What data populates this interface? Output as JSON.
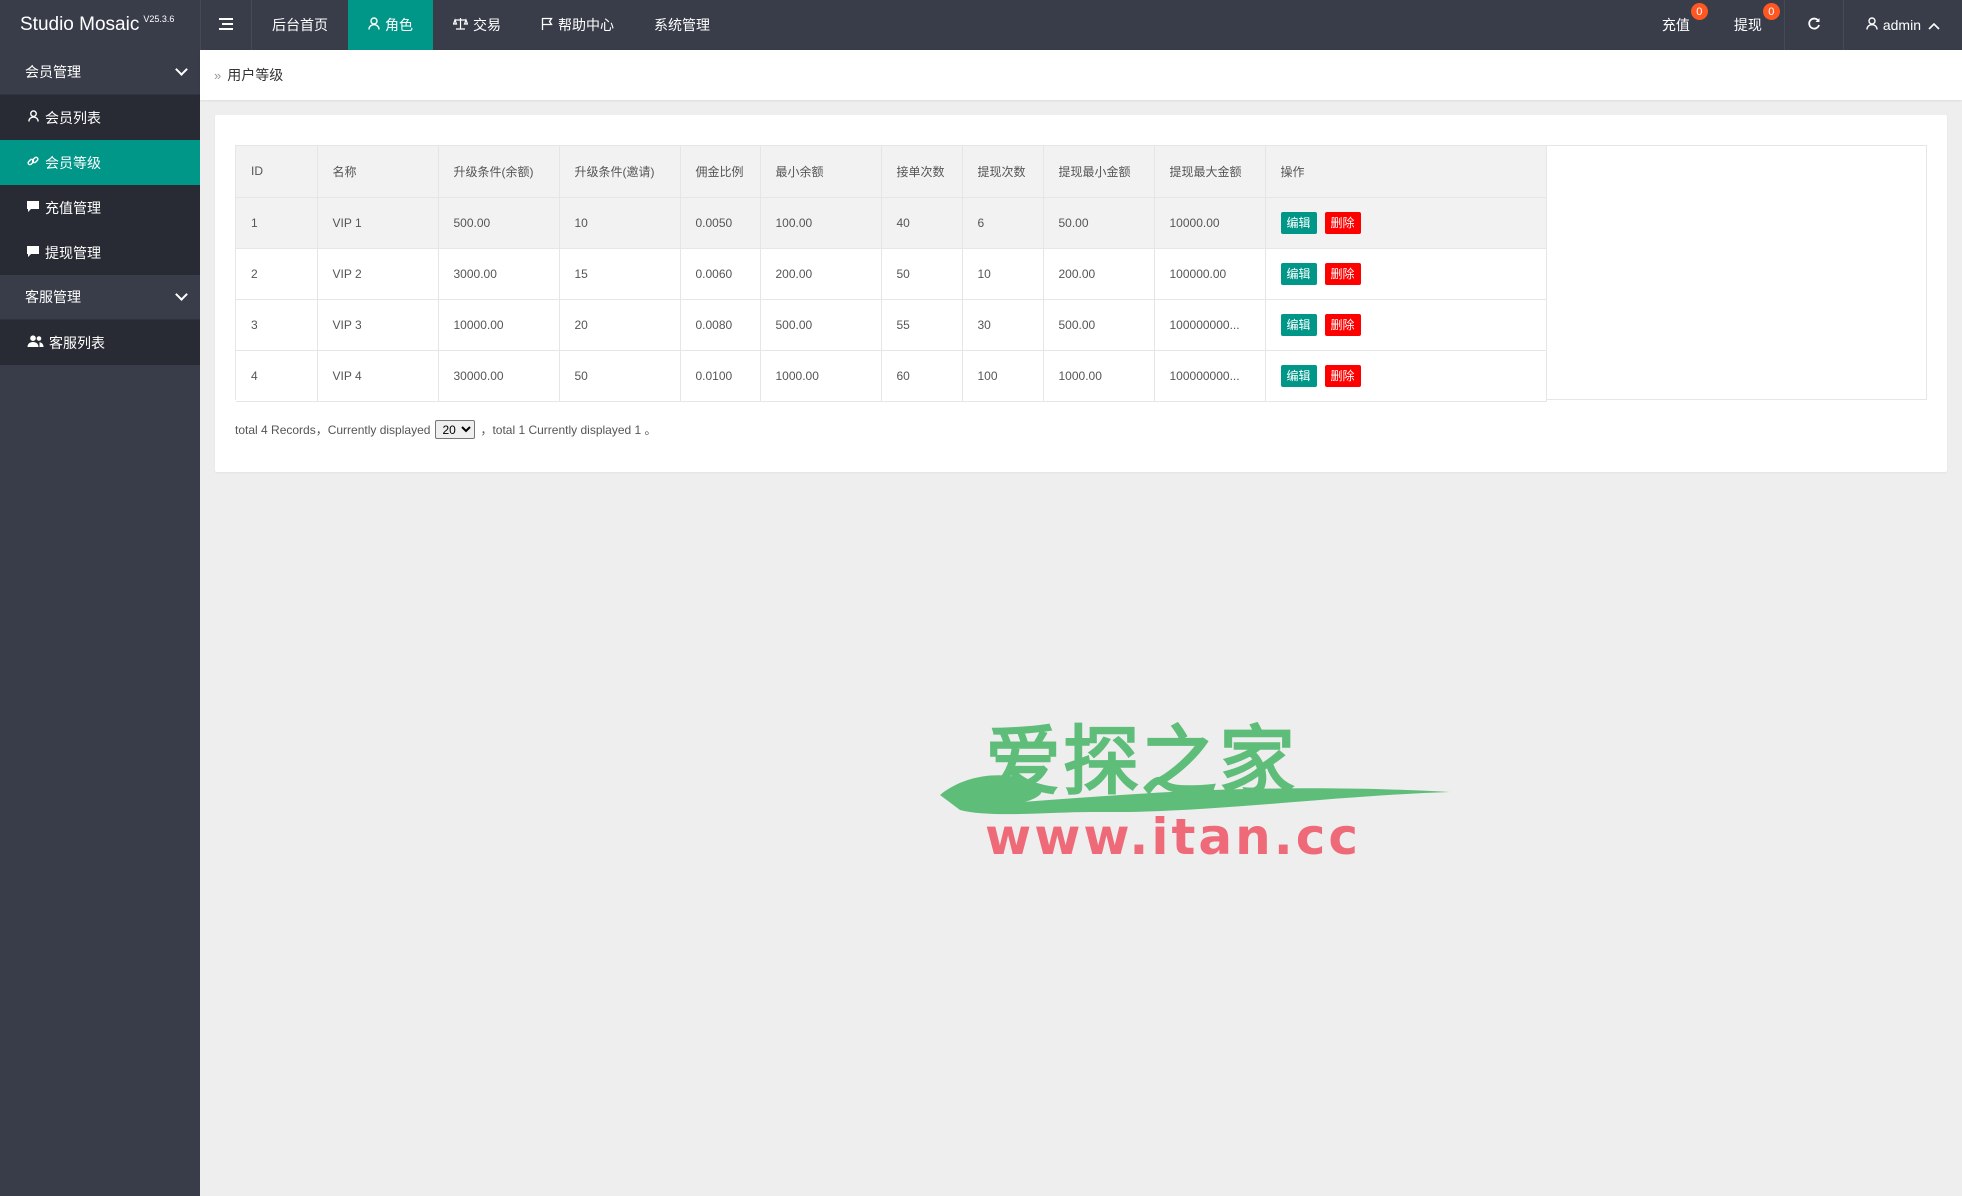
{
  "app": {
    "name": "Studio Mosaic",
    "version": "V25.3.6"
  },
  "topnav": {
    "items": [
      {
        "label": "后台首页",
        "icon": ""
      },
      {
        "label": "角色",
        "icon": "user-icon"
      },
      {
        "label": "交易",
        "icon": "scale-icon"
      },
      {
        "label": "帮助中心",
        "icon": "flag-icon"
      },
      {
        "label": "系统管理",
        "icon": ""
      }
    ],
    "active": "角色"
  },
  "header_right": {
    "recharge_label": "充值",
    "recharge_count": "0",
    "withdraw_label": "提现",
    "withdraw_count": "0",
    "user": "admin"
  },
  "sidebar": {
    "groups": [
      {
        "title": "会员管理",
        "items": [
          {
            "label": "会员列表",
            "icon": "user-icon"
          },
          {
            "label": "会员等级",
            "icon": "link-icon"
          },
          {
            "label": "充值管理",
            "icon": "message-icon"
          },
          {
            "label": "提现管理",
            "icon": "message-icon"
          }
        ]
      },
      {
        "title": "客服管理",
        "items": [
          {
            "label": "客服列表",
            "icon": "users-icon"
          }
        ]
      }
    ],
    "active": "会员等级"
  },
  "breadcrumb": {
    "current": "用户等级"
  },
  "table": {
    "headers": [
      "ID",
      "名称",
      "升级条件(余额)",
      "升级条件(邀请)",
      "佣金比例",
      "最小余额",
      "接单次数",
      "提现次数",
      "提现最小金额",
      "提现最大金额",
      "操作"
    ],
    "rows": [
      [
        "1",
        "VIP 1",
        "500.00",
        "10",
        "0.0050",
        "100.00",
        "40",
        "6",
        "50.00",
        "10000.00"
      ],
      [
        "2",
        "VIP 2",
        "3000.00",
        "15",
        "0.0060",
        "200.00",
        "50",
        "10",
        "200.00",
        "100000.00"
      ],
      [
        "3",
        "VIP 3",
        "10000.00",
        "20",
        "0.0080",
        "500.00",
        "55",
        "30",
        "500.00",
        "100000000..."
      ],
      [
        "4",
        "VIP 4",
        "30000.00",
        "50",
        "0.0100",
        "1000.00",
        "60",
        "100",
        "1000.00",
        "100000000..."
      ]
    ],
    "edit_label": "编辑",
    "delete_label": "删除"
  },
  "pagination": {
    "prefix": "total 4 Records，Currently displayed",
    "page_size": "20",
    "suffix": "，total 1 Currently displayed 1 。"
  },
  "watermark": {
    "cn": "爱探之家",
    "url": "www.itan.cc"
  },
  "colors": {
    "header_bg": "#393d49",
    "accent": "#009688",
    "danger": "#ff0000",
    "badge": "#ff5722"
  }
}
